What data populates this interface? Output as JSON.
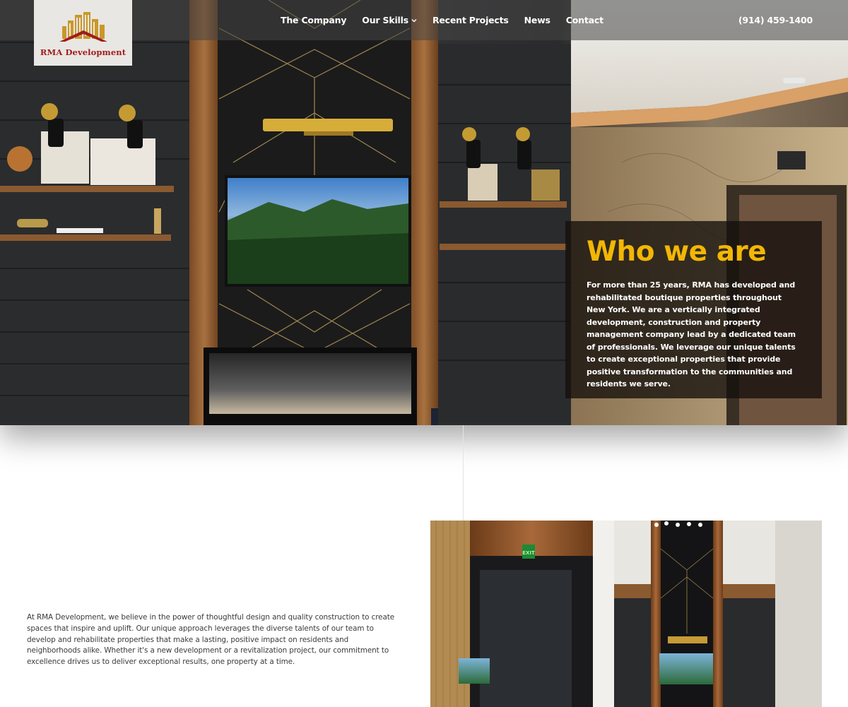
{
  "brand": {
    "logo_text": "RMA Development",
    "colors": {
      "logo_red": "#a01c1c",
      "logo_gold": "#c9982b",
      "accent_yellow": "#f2b705"
    }
  },
  "nav": {
    "items": [
      {
        "label": "The Company"
      },
      {
        "label": "Our Skills",
        "has_dropdown": true,
        "icon": "chevron-down-icon"
      },
      {
        "label": "Recent Projects"
      },
      {
        "label": "News"
      },
      {
        "label": "Contact"
      }
    ],
    "phone": "(914) 459-1400"
  },
  "hero": {
    "title": "Who we are",
    "body": "For more than 25 years, RMA has developed and rehabilitated boutique properties throughout New York. We are a vertically integrated development, construction and property management company lead by a dedicated team of professionals. We leverage our unique talents to create exceptional properties that provide positive transformation to the communities and residents we serve."
  },
  "about": {
    "body": "At RMA Development, we believe in the power of thoughtful design and quality construction to create spaces that inspire and uplift. Our unique approach leverages the diverse talents of our team to develop and rehabilitate properties that make a lasting, positive impact on residents and neighborhoods alike. Whether it's a new development or a revitalization project, our commitment to excellence drives us to deliver exceptional results, one property at a time."
  },
  "photos": {
    "hero_signs": [],
    "lobby_signs": [
      "EXIT"
    ]
  }
}
